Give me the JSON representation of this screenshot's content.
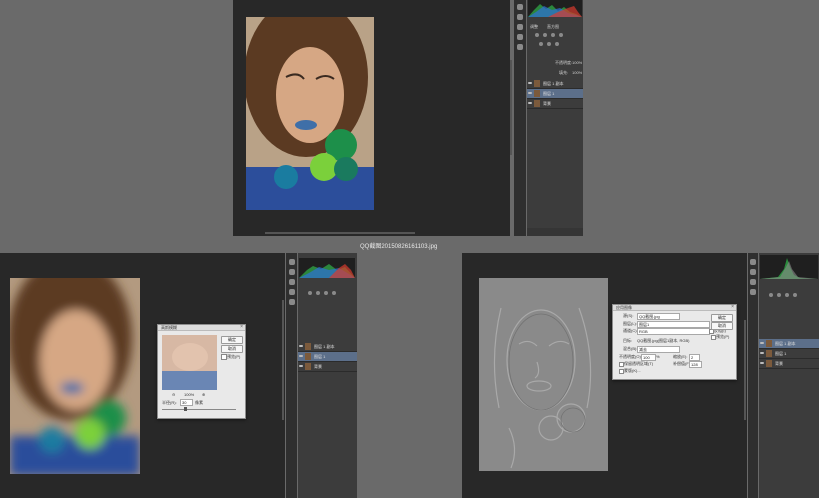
{
  "caption": "QQ截图20150826161103.jpg",
  "top_window": {
    "panel_header": "调整",
    "histogram_label": "直方图",
    "opacity_label": "不透明度:",
    "opacity_value": "100%",
    "fill_label": "填充:",
    "fill_value": "100%",
    "layers": [
      {
        "name": "图层 1 副本"
      },
      {
        "name": "图层 1"
      },
      {
        "name": "背景"
      }
    ],
    "selected_layer_index": 1
  },
  "bottom_left_window": {
    "layers": [
      {
        "name": "图层 1 副本"
      },
      {
        "name": "图层 1"
      },
      {
        "name": "背景"
      }
    ],
    "selected_layer_index": 1,
    "dialog": {
      "title": "高斯模糊",
      "ok_label": "确定",
      "cancel_label": "取消",
      "preview_label": "预览(P)",
      "zoom": "100%",
      "radius_label": "半径(R):",
      "radius_value": "30",
      "radius_unit": "像素"
    }
  },
  "bottom_right_window": {
    "layers": [
      {
        "name": "图层 1 副本"
      },
      {
        "name": "图层 1"
      },
      {
        "name": "背景"
      }
    ],
    "selected_layer_index": 0,
    "dialog": {
      "title": "应用图像",
      "source_label": "源(S):",
      "source_value": "QQ截图.jpg",
      "layer_label": "图层(L):",
      "layer_value": "图层1",
      "channel_label": "通道(C):",
      "channel_value": "RGB",
      "invert_label": "反相(I)",
      "target_label": "目标:",
      "target_value": "QQ截图.jpg(图层1副本, RGB)",
      "blending_label": "混合(B):",
      "blending_value": "减去",
      "opacity_label": "不透明度(O):",
      "opacity_value": "100",
      "scale_label": "缩放(E):",
      "scale_value": "2",
      "offset_label": "补偿值(F):",
      "offset_value": "128",
      "preserve_label": "保留透明区域(T)",
      "mask_label": "蒙版(K)...",
      "ok_label": "确定",
      "cancel_label": "取消",
      "preview_label": "预览(P)"
    }
  },
  "colors": {
    "workspace": "#6a6a6a",
    "canvas_bg": "#282828",
    "panel_bg": "#3c3c3c",
    "selected_layer": "#5c6f8a",
    "dialog_bg": "#e9e9e9"
  }
}
